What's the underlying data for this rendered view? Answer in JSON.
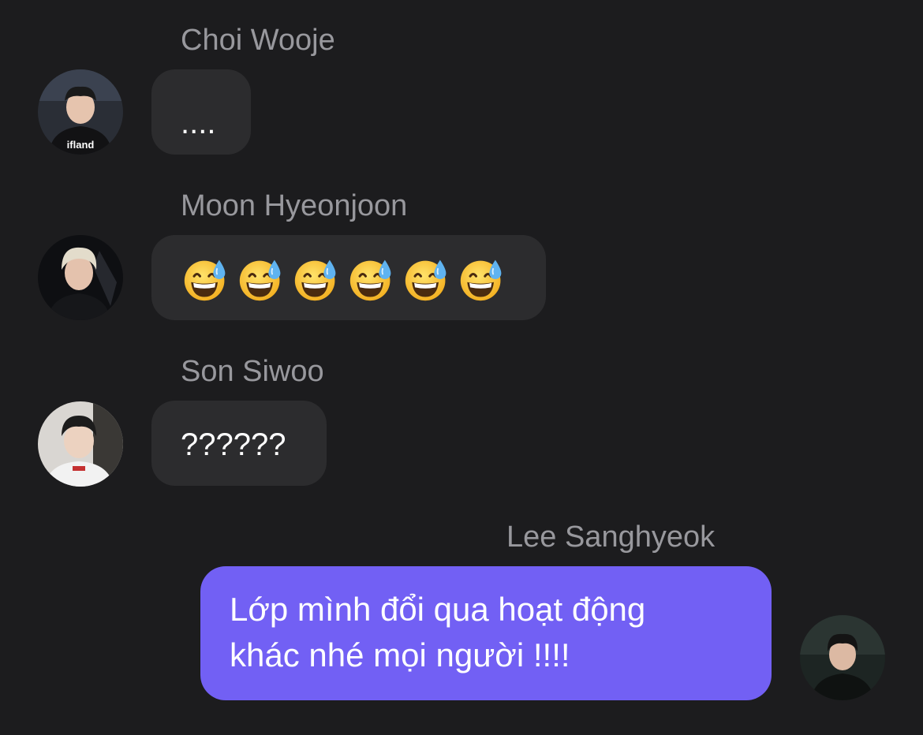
{
  "messages": [
    {
      "sender": "Choi Wooje",
      "text": "....",
      "avatar_icon": "user-avatar-choi-wooje"
    },
    {
      "sender": "Moon Hyeonjoon",
      "emoji": "😅",
      "emoji_count": 6,
      "avatar_icon": "user-avatar-moon-hyeonjoon"
    },
    {
      "sender": "Son Siwoo",
      "text": "??????",
      "avatar_icon": "user-avatar-son-siwoo"
    },
    {
      "sender": "Lee Sanghyeok",
      "text_line1": "Lớp mình đổi qua hoạt động",
      "text_line2": "khác nhé mọi người !!!!",
      "avatar_icon": "user-avatar-lee-sanghyeok"
    }
  ],
  "colors": {
    "background": "#1c1c1e",
    "incoming_bubble": "#2c2c2e",
    "outgoing_bubble": "#7260f4",
    "sender_name": "#98989d"
  }
}
